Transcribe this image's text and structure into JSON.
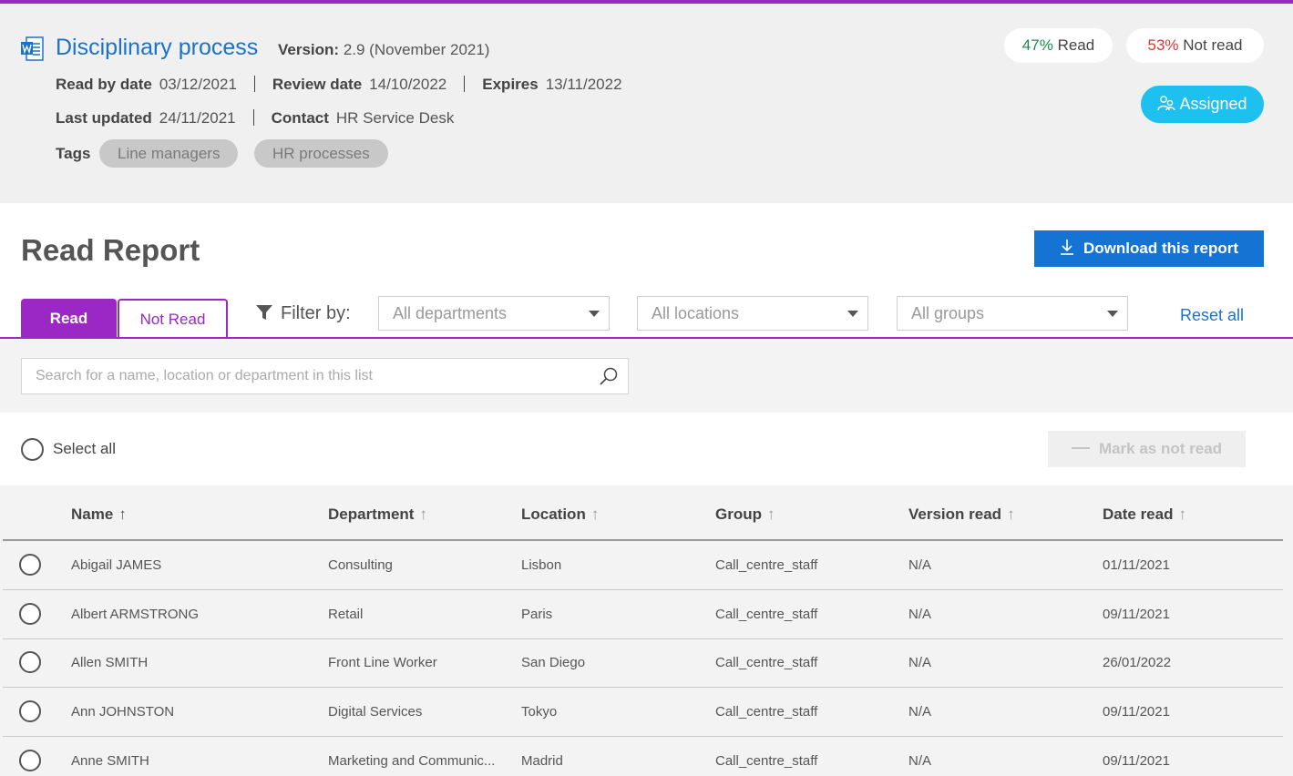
{
  "colors": {
    "accent": "#9b27c4",
    "link": "#1a73c8",
    "primary_button": "#1473d3",
    "assigned": "#1ec0f0"
  },
  "document": {
    "icon": "word-doc-icon",
    "title": "Disciplinary process",
    "version_label": "Version:",
    "version_value": "2.9 (November 2021)",
    "read_by_label": "Read by date",
    "read_by_value": "03/12/2021",
    "review_label": "Review date",
    "review_value": "14/10/2022",
    "expires_label": "Expires",
    "expires_value": "13/11/2022",
    "updated_label": "Last updated",
    "updated_value": "24/11/2021",
    "contact_label": "Contact",
    "contact_value": "HR Service Desk",
    "tags_label": "Tags",
    "tags": [
      "Line managers",
      "HR processes"
    ]
  },
  "stats": {
    "read_pct": "47%",
    "read_label": "Read",
    "notread_pct": "53%",
    "notread_label": "Not read",
    "assigned_label": "Assigned"
  },
  "report": {
    "title": "Read Report",
    "download_label": "Download this report",
    "tabs": [
      "Read",
      "Not Read"
    ],
    "filter_label": "Filter by:",
    "filters": [
      "All departments",
      "All locations",
      "All groups"
    ],
    "reset_label": "Reset all",
    "search_placeholder": "Search for a name, location or department in this list",
    "select_all_label": "Select all",
    "mark_label": "Mark as not read"
  },
  "table": {
    "headers": [
      "Name",
      "Department",
      "Location",
      "Group",
      "Version read",
      "Date read"
    ],
    "rows": [
      [
        "Abigail JAMES",
        "Consulting",
        "Lisbon",
        "Call_centre_staff",
        "N/A",
        "01/11/2021"
      ],
      [
        "Albert ARMSTRONG",
        "Retail",
        "Paris",
        "Call_centre_staff",
        "N/A",
        "09/11/2021"
      ],
      [
        "Allen SMITH",
        "Front Line Worker",
        "San Diego",
        "Call_centre_staff",
        "N/A",
        "26/01/2022"
      ],
      [
        "Ann JOHNSTON",
        "Digital Services",
        "Tokyo",
        "Call_centre_staff",
        "N/A",
        "09/11/2021"
      ],
      [
        "Anne SMITH",
        "Marketing and Communic...",
        "Madrid",
        "Call_centre_staff",
        "N/A",
        "09/11/2021"
      ]
    ]
  }
}
